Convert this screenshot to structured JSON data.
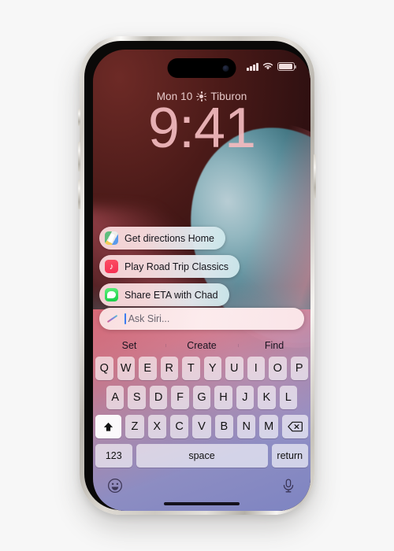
{
  "device": {
    "model_label": "iPhone",
    "frame_color": "#cdc9c2"
  },
  "status_bar": {
    "cellular_icon": "cellular-bars-icon",
    "wifi_icon": "wifi-icon",
    "battery_icon": "battery-icon",
    "battery_level_pct": 82
  },
  "lock_screen": {
    "date": "Mon 10",
    "weather_icon": "sun-icon",
    "location": "Tiburon",
    "time": "9:41"
  },
  "siri_suggestions": [
    {
      "icon": "maps-app-icon",
      "label": "Get directions Home"
    },
    {
      "icon": "music-app-icon",
      "label": "Play Road Trip Classics"
    },
    {
      "icon": "messages-app-icon",
      "label": "Share ETA with Chad"
    }
  ],
  "siri_field": {
    "icon": "siri-glyph-icon",
    "placeholder": "Ask Siri...",
    "value": ""
  },
  "keyboard": {
    "predictions": [
      "Set",
      "Create",
      "Find"
    ],
    "row1": [
      "Q",
      "W",
      "E",
      "R",
      "T",
      "Y",
      "U",
      "I",
      "O",
      "P"
    ],
    "row2": [
      "A",
      "S",
      "D",
      "F",
      "G",
      "H",
      "J",
      "K",
      "L"
    ],
    "row3_letters": [
      "Z",
      "X",
      "C",
      "V",
      "B",
      "N",
      "M"
    ],
    "shift_key": "shift-arrow-icon",
    "backspace_key": "backspace-delete-icon",
    "numbers_key": "123",
    "space_key": "space",
    "return_key": "return",
    "emoji_key": "emoji-smiley-icon",
    "dictation_key": "microphone-icon"
  },
  "colors": {
    "page_background": "#f7f7f7",
    "wallpaper_dark": "#2c0f10",
    "wallpaper_teal": "#2f6470",
    "wallpaper_pink": "#eb6e7d",
    "keyboard_key": "rgba(255,255,255,0.62)",
    "caret_blue": "#3c7cf0"
  }
}
